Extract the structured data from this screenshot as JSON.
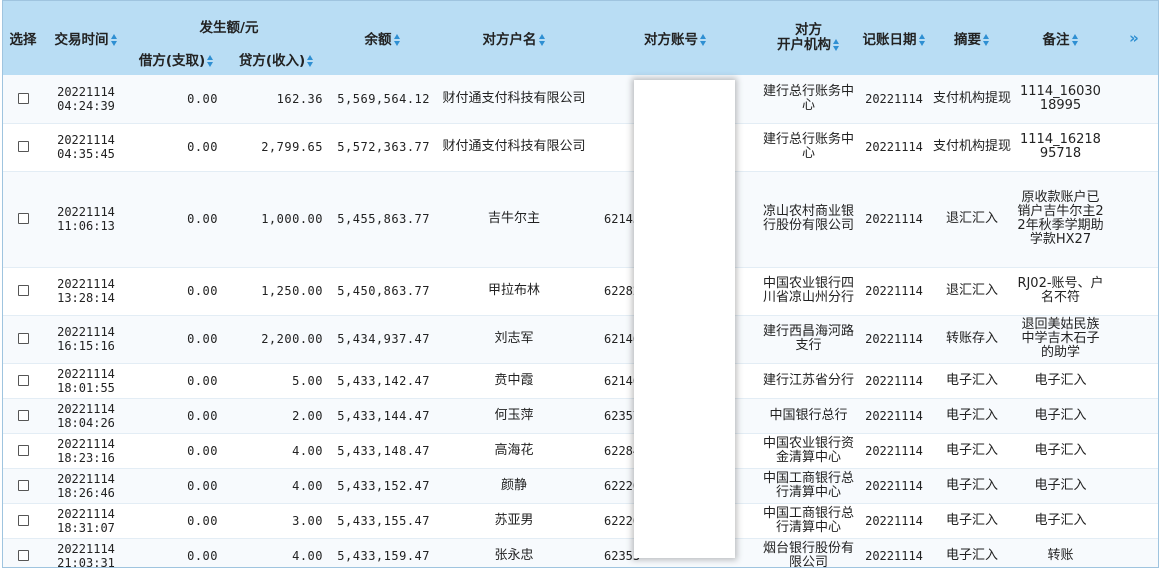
{
  "header": {
    "select": "选择",
    "trade_time": "交易时间",
    "amount_group": "发生额/元",
    "debit": "借方(支取)",
    "credit": "贷方(收入)",
    "balance": "余额",
    "party_name": "对方户名",
    "party_account": "对方账号",
    "party_bank_line1": "对方",
    "party_bank_line2": "开户机构",
    "book_date": "记账日期",
    "summary": "摘要",
    "remark": "备注",
    "expand": "»"
  },
  "rows": [
    {
      "date": "20221114",
      "time": "04:24:39",
      "debit": "0.00",
      "credit": "162.36",
      "balance": "5,569,564.12",
      "name": "财付通支付科技有限公司",
      "account": "",
      "bank": "建行总行账务中心",
      "book_date": "20221114",
      "summary": "支付机构提现",
      "remark": "1114_1603018995"
    },
    {
      "date": "20221114",
      "time": "04:35:45",
      "debit": "0.00",
      "credit": "2,799.65",
      "balance": "5,572,363.77",
      "name": "财付通支付科技有限公司",
      "account": "",
      "bank": "建行总行账务中心",
      "book_date": "20221114",
      "summary": "支付机构提现",
      "remark": "1114_1621895718"
    },
    {
      "date": "20221114",
      "time": "11:06:13",
      "debit": "0.00",
      "credit": "1,000.00",
      "balance": "5,455,863.77",
      "name": "吉牛尔主",
      "account": "62145",
      "bank": "凉山农村商业银行股份有限公司",
      "book_date": "20221114",
      "summary": "退汇汇入",
      "remark": "原收款账户已销户吉牛尔主22年秋季学期助学款HX27"
    },
    {
      "date": "20221114",
      "time": "13:28:14",
      "debit": "0.00",
      "credit": "1,250.00",
      "balance": "5,450,863.77",
      "name": "甲拉布林",
      "account": "62282",
      "bank": "中国农业银行四川省凉山州分行",
      "book_date": "20221114",
      "summary": "退汇汇入",
      "remark": "RJ02-账号、户名不符"
    },
    {
      "date": "20221114",
      "time": "16:15:16",
      "debit": "0.00",
      "credit": "2,200.00",
      "balance": "5,434,937.47",
      "name": "刘志军",
      "account": "62146",
      "bank": "建行西昌海河路支行",
      "book_date": "20221114",
      "summary": "转账存入",
      "remark": "退回美姑民族中学吉木石子的助学"
    },
    {
      "date": "20221114",
      "time": "18:01:55",
      "debit": "0.00",
      "credit": "5.00",
      "balance": "5,433,142.47",
      "name": "贲中霞",
      "account": "62146",
      "bank": "建行江苏省分行",
      "book_date": "20221114",
      "summary": "电子汇入",
      "remark": "电子汇入"
    },
    {
      "date": "20221114",
      "time": "18:04:26",
      "debit": "0.00",
      "credit": "2.00",
      "balance": "5,433,144.47",
      "name": "何玉萍",
      "account": "62357",
      "bank": "中国银行总行",
      "book_date": "20221114",
      "summary": "电子汇入",
      "remark": "电子汇入"
    },
    {
      "date": "20221114",
      "time": "18:23:16",
      "debit": "0.00",
      "credit": "4.00",
      "balance": "5,433,148.47",
      "name": "高海花",
      "account": "62284",
      "bank": "中国农业银行资金清算中心",
      "book_date": "20221114",
      "summary": "电子汇入",
      "remark": "电子汇入"
    },
    {
      "date": "20221114",
      "time": "18:26:46",
      "debit": "0.00",
      "credit": "4.00",
      "balance": "5,433,152.47",
      "name": "颜静",
      "account": "62220",
      "bank": "中国工商银行总行清算中心",
      "book_date": "20221114",
      "summary": "电子汇入",
      "remark": "电子汇入"
    },
    {
      "date": "20221114",
      "time": "18:31:07",
      "debit": "0.00",
      "credit": "3.00",
      "balance": "5,433,155.47",
      "name": "苏亚男",
      "account": "62220",
      "bank": "中国工商银行总行清算中心",
      "book_date": "20221114",
      "summary": "电子汇入",
      "remark": "电子汇入"
    },
    {
      "date": "20221114",
      "time": "21:03:31",
      "debit": "0.00",
      "credit": "4.00",
      "balance": "5,433,159.47",
      "name": "张永忠",
      "account": "62353",
      "bank": "烟台银行股份有限公司",
      "book_date": "20221114",
      "summary": "电子汇入",
      "remark": "转账"
    }
  ]
}
